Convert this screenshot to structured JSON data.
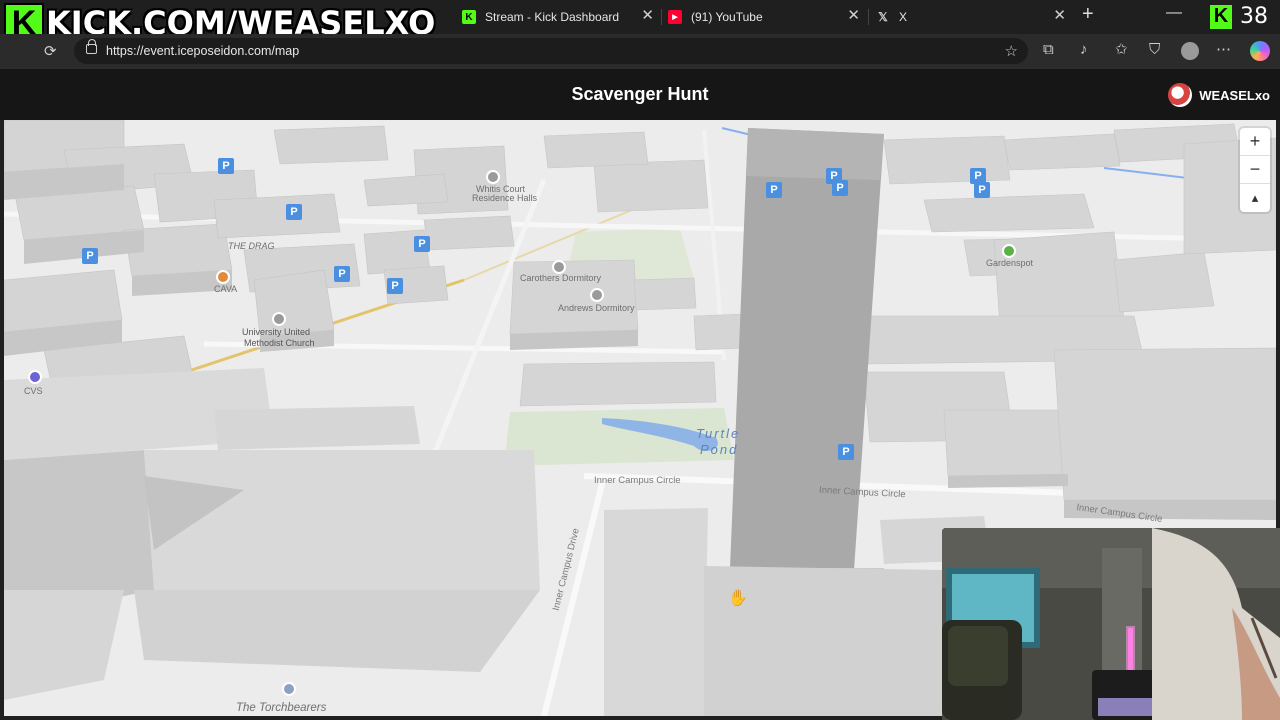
{
  "overlay": {
    "brand_letter": "K",
    "banner_text": "KICK.COM/WEASELXO",
    "viewer_count": "38"
  },
  "browser": {
    "tabs": [
      {
        "title": "Stream - Kick Dashboard",
        "icon": "kick-icon"
      },
      {
        "title": "(91) YouTube",
        "icon": "youtube-icon"
      },
      {
        "title": "X",
        "icon": "x-icon"
      }
    ],
    "url": "https://event.iceposeidon.com/map"
  },
  "page": {
    "title": "Scavenger Hunt",
    "username": "WEASELxo"
  },
  "map": {
    "zoom_controls": {
      "zoom_in": "+",
      "zoom_out": "−",
      "compass": "▴"
    },
    "parking_label": "P",
    "labels": {
      "the_drag": "THE DRAG",
      "cava": "CAVA",
      "church_line1": "University United",
      "church_line2": "Methodist Church",
      "cvs": "CVS",
      "carothers": "Carothers Dormitory",
      "andrews": "Andrews Dormitory",
      "whitis_court": "Whitis Court",
      "whitis_court2": "Residence Halls",
      "gardenspot": "Gardenspot",
      "pond_line1": "Turtle",
      "pond_line2": "Pond",
      "inner_campus_circle": "Inner Campus Circle",
      "inner_campus_drive": "Inner Campus Drive",
      "torchbearers": "The Torchbearers"
    }
  },
  "colors": {
    "kick_green": "#53fc18",
    "map_bg": "#ececec",
    "building": "#cfcfcf",
    "parking": "#4a8fe0"
  }
}
